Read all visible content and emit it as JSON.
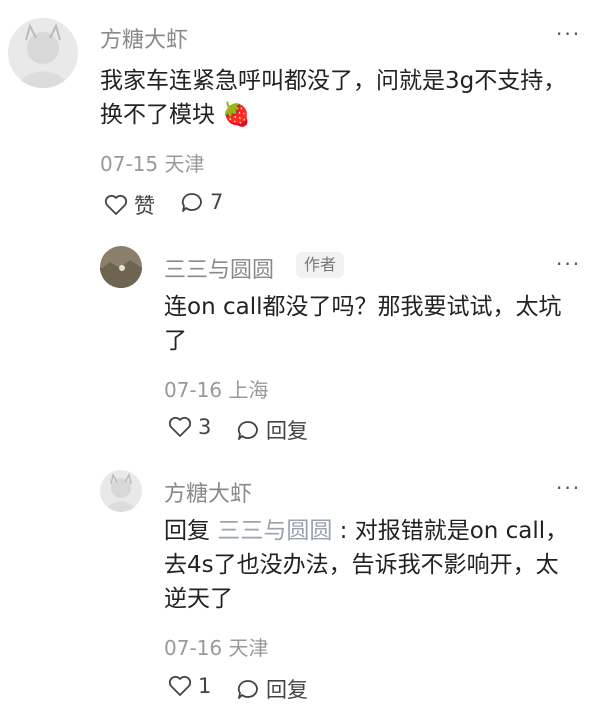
{
  "comment": {
    "author": "方糖大虾",
    "text": "我家车连紧急呼叫都没了，问就是3g不支持，换不了模块",
    "emoji": "🍓",
    "date": "07-15",
    "location": "天津",
    "like_label": "赞",
    "reply_count": "7",
    "more": "···"
  },
  "replies": [
    {
      "author": "三三与圆圆",
      "badge": "作者",
      "text": "连on call都没了吗？那我要试试，太坑了",
      "date": "07-16",
      "location": "上海",
      "like_count": "3",
      "reply_label": "回复",
      "more": "···"
    },
    {
      "author": "方糖大虾",
      "reply_prefix": "回复",
      "mention": "三三与圆圆",
      "separator": ":",
      "text": "对报错就是on call，去4s了也没办法，告诉我不影响开，太逆天了",
      "date": "07-16",
      "location": "天津",
      "like_count": "1",
      "reply_label": "回复",
      "more": "···"
    }
  ],
  "icons": {
    "like": "heart-outline-icon",
    "comment": "speech-bubble-outline-icon"
  }
}
